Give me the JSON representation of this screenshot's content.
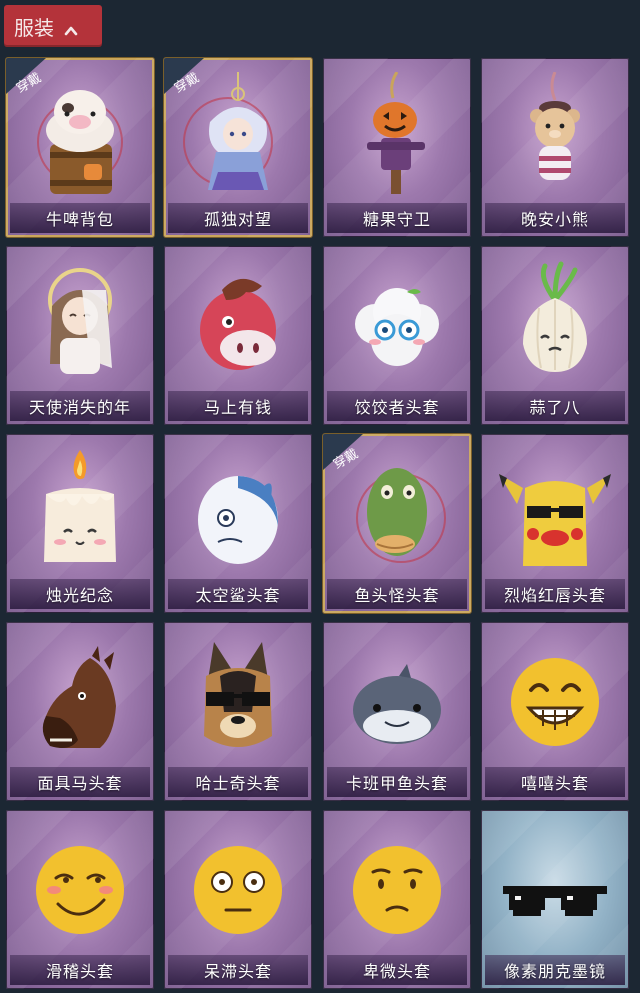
{
  "header": {
    "title": "服装",
    "chevron_icon": "chevron-up-icon"
  },
  "colors": {
    "background": "#1c2733",
    "header_red": "#b4333a",
    "card_purple": "#9d79ad",
    "card_blue": "#93b3c7",
    "equipped_gold": "#c9a55a",
    "badge_navy": "#2b3a4e"
  },
  "equipped_badge": "穿戴",
  "items": [
    {
      "label": "牛啤背包",
      "equipped": true,
      "art": "cow-beer-barrel-icon",
      "tint": "purple"
    },
    {
      "label": "孤独对望",
      "equipped": true,
      "art": "fairy-doll-pendant-icon",
      "tint": "purple"
    },
    {
      "label": "糖果守卫",
      "equipped": false,
      "art": "pumpkin-scarecrow-pendant-icon",
      "tint": "purple"
    },
    {
      "label": "晚安小熊",
      "equipped": false,
      "art": "teddy-bear-pendant-icon",
      "tint": "purple"
    },
    {
      "label": "天使消失的年",
      "equipped": false,
      "art": "angel-girl-doll-icon",
      "tint": "purple"
    },
    {
      "label": "马上有钱",
      "equipped": false,
      "art": "red-horse-head-icon",
      "tint": "purple"
    },
    {
      "label": "饺饺者头套",
      "equipped": false,
      "art": "cloud-dumpling-head-icon",
      "tint": "purple"
    },
    {
      "label": "蒜了八",
      "equipped": false,
      "art": "garlic-head-icon",
      "tint": "purple"
    },
    {
      "label": "烛光纪念",
      "equipped": false,
      "art": "candle-head-icon",
      "tint": "purple"
    },
    {
      "label": "太空鲨头套",
      "equipped": false,
      "art": "space-shark-head-icon",
      "tint": "purple"
    },
    {
      "label": "鱼头怪头套",
      "equipped": true,
      "art": "fish-head-mask-icon",
      "tint": "purple"
    },
    {
      "label": "烈焰红唇头套",
      "equipped": false,
      "art": "pikachu-lips-head-icon",
      "tint": "purple"
    },
    {
      "label": "面具马头套",
      "equipped": false,
      "art": "horse-mask-icon",
      "tint": "purple"
    },
    {
      "label": "哈士奇头套",
      "equipped": false,
      "art": "husky-head-sunglasses-icon",
      "tint": "purple"
    },
    {
      "label": "卡班甲鱼头套",
      "equipped": false,
      "art": "grey-fish-head-icon",
      "tint": "purple"
    },
    {
      "label": "嘻嘻头套",
      "equipped": false,
      "art": "grin-emoji-head-icon",
      "tint": "purple"
    },
    {
      "label": "滑稽头套",
      "equipped": false,
      "art": "funny-emoji-head-icon",
      "tint": "purple"
    },
    {
      "label": "呆滞头套",
      "equipped": false,
      "art": "dazed-emoji-head-icon",
      "tint": "purple"
    },
    {
      "label": "卑微头套",
      "equipped": false,
      "art": "humble-emoji-head-icon",
      "tint": "purple"
    },
    {
      "label": "像素朋克墨镜",
      "equipped": false,
      "art": "pixel-sunglasses-icon",
      "tint": "blue"
    }
  ]
}
